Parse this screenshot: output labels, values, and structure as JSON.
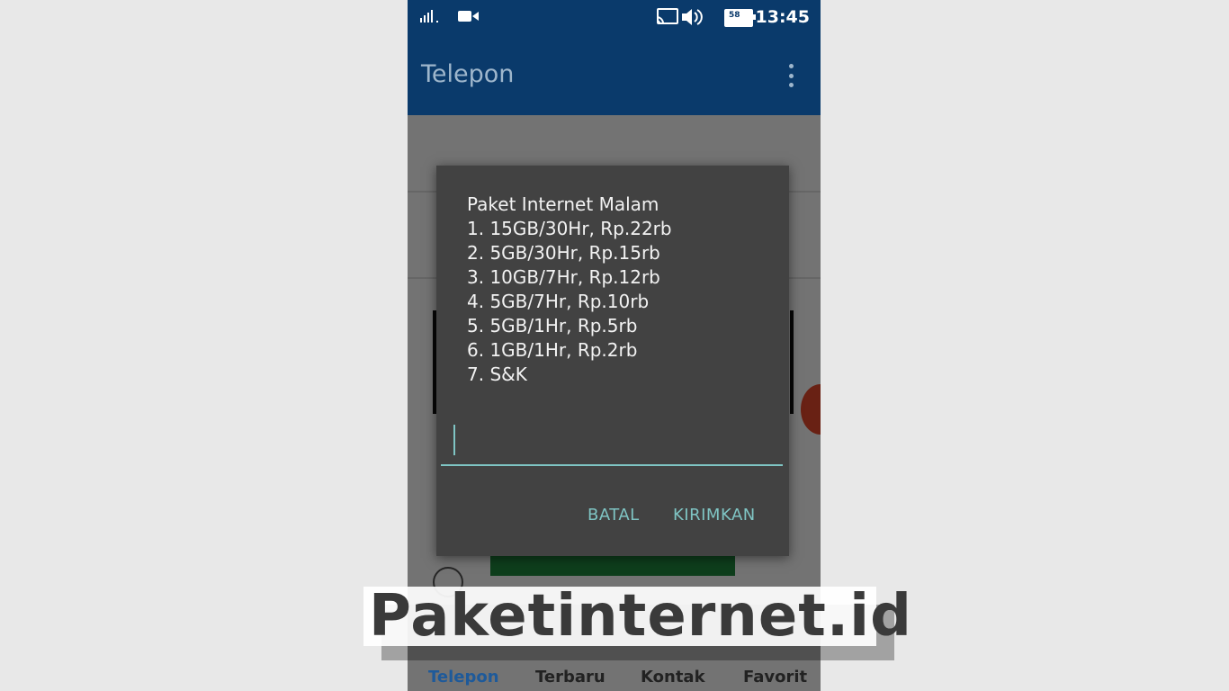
{
  "status_bar": {
    "time": "13:45",
    "battery_level": "58",
    "icons": [
      "signal-icon",
      "video-icon",
      "cast-icon",
      "volume-icon",
      "battery-icon"
    ]
  },
  "app_bar": {
    "title": "Telepon",
    "menu_icon": "more-vert-icon"
  },
  "dialog": {
    "lines": [
      "Paket Internet Malam",
      "1. 15GB/30Hr, Rp.22rb",
      "2. 5GB/30Hr, Rp.15rb",
      "3. 10GB/7Hr, Rp.12rb",
      "4. 5GB/7Hr, Rp.10rb",
      "5. 5GB/1Hr, Rp.5rb",
      "6. 1GB/1Hr, Rp.2rb",
      "7. S&K"
    ],
    "input_value": "",
    "cancel_label": "BATAL",
    "send_label": "KIRIMKAN"
  },
  "tabs": [
    {
      "label": "Telepon",
      "active": true
    },
    {
      "label": "Terbaru",
      "active": false
    },
    {
      "label": "Kontak",
      "active": false
    },
    {
      "label": "Favorit",
      "active": false
    }
  ],
  "watermark": "Paketinternet.id",
  "colors": {
    "app_bar": "#0a3a6b",
    "dialog_bg": "#424242",
    "accent": "#7fc5c4",
    "call_button": "#1f8b3f",
    "fab": "#e84a2d"
  }
}
